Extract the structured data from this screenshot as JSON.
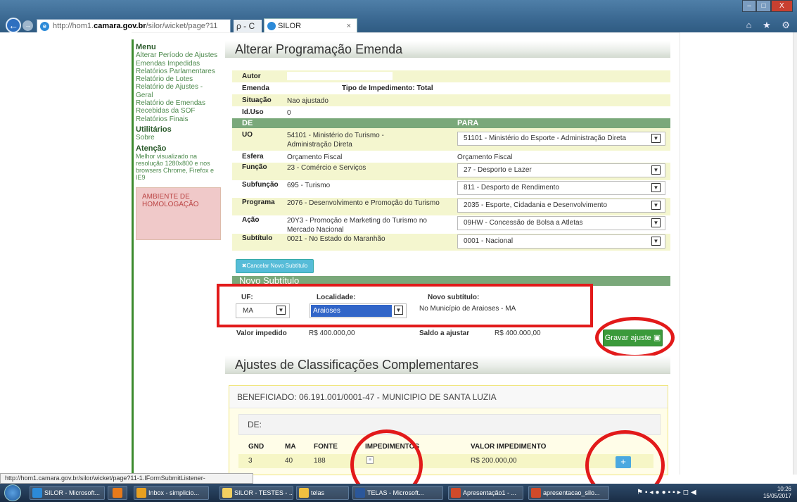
{
  "browser": {
    "url_prefix": "http://hom1.",
    "url_domain": "camara.gov.br",
    "url_suffix": "/silor/wicket/page?11",
    "addr_controls": "ρ - C",
    "tab_title": "SILOR",
    "tab_close": "×",
    "win_min": "–",
    "win_max": "□",
    "win_close": "X",
    "tools": "⌂ ★ ⚙"
  },
  "sidebar": {
    "menu_title": "Menu",
    "menu_items": [
      "Alterar Período de Ajustes",
      "Emendas Impedidas",
      "Relatórios Parlamentares",
      "Relatório de Lotes",
      "Relatório de Ajustes - Geral",
      "Relatório de Emendas Recebidas da SOF",
      "Relatórios Finais"
    ],
    "util_title": "Utilitários",
    "util_items": [
      "Sobre"
    ],
    "atencao_title": "Atenção",
    "atencao_text": "Melhor visualizado na resolução 1280x800 e nos browsers Chrome, Firefox e IE9",
    "ambiente": "AMBIENTE DE HOMOLOGAÇÃO"
  },
  "page": {
    "title": "Alterar Programação Emenda"
  },
  "info": {
    "autor_label": "Autor",
    "autor_value": "",
    "emenda_label": "Emenda",
    "tipo_label": "Tipo de Impedimento: Total",
    "situacao_label": "Situação",
    "situacao_value": "Nao ajustado",
    "iduso_label": "Id.Uso",
    "iduso_value": "0",
    "de_label": "DE",
    "para_label": "PARA"
  },
  "rows": {
    "uo": {
      "label": "UO",
      "de": "54101 - Ministério do Turismo - Administração Direta",
      "para": "51101 - Ministério do Esporte - Administração Direta"
    },
    "esfera": {
      "label": "Esfera",
      "de": "Orçamento Fiscal",
      "para": "Orçamento Fiscal"
    },
    "funcao": {
      "label": "Função",
      "de": "23 - Comércio e Serviços",
      "para": "27 - Desporto e Lazer"
    },
    "subfuncao": {
      "label": "Subfunção",
      "de": "695 - Turismo",
      "para": "811 - Desporto de Rendimento"
    },
    "programa": {
      "label": "Programa",
      "de": "2076 - Desenvolvimento e Promoção do Turismo",
      "para": "2035 - Esporte, Cidadania e Desenvolvimento"
    },
    "acao": {
      "label": "Ação",
      "de": "20Y3 - Promoção e Marketing do Turismo no Mercado Nacional",
      "para": "09HW - Concessão de Bolsa a Atletas"
    },
    "subtitulo": {
      "label": "Subtítulo",
      "de": "0021 - No Estado do Maranhão",
      "para": "0001 - Nacional"
    }
  },
  "cancel_button": "✖Cancelar Novo Subtítulo",
  "novo": {
    "header": "Novo Subtítulo",
    "uf_label": "UF:",
    "uf_value": "MA",
    "localidade_label": "Localidade:",
    "localidade_value": "Araioses",
    "novo_label": "Novo subtítulo:",
    "novo_value": "No Município de Araioses - MA"
  },
  "valores": {
    "impedido_label": "Valor impedido",
    "impedido_value": "R$ 400.000,00",
    "saldo_label": "Saldo a ajustar",
    "saldo_value": "R$ 400.000,00"
  },
  "gravar_button": "Gravar ajuste",
  "ajustes": {
    "title": "Ajustes de Classificações Complementares",
    "beneficiado": "BENEFICIADO: 06.191.001/0001-47 - MUNICIPIO DE SANTA LUZIA",
    "de_label": "DE:",
    "columns": [
      "GND",
      "MA",
      "FONTE",
      "IMPEDIMENTOS",
      "VALOR IMPEDIMENTO"
    ],
    "row": {
      "gnd": "3",
      "ma": "40",
      "fonte": "188",
      "valor": "R$ 200.000,00"
    },
    "plus": "+"
  },
  "status": "http://hom1.camara.gov.br/silor/wicket/page?11-1.IFormSubmitListener-espelhoEmenda-form",
  "taskbar": {
    "items": [
      "SILOR - Microsoft...",
      "",
      "Inbox - simplicio...",
      "SILOR - TESTES - ...",
      "telas",
      "TELAS - Microsoft...",
      "Apresentação1 - ...",
      "apresentacao_silo..."
    ],
    "time": "10:26",
    "date": "15/05/2017"
  }
}
